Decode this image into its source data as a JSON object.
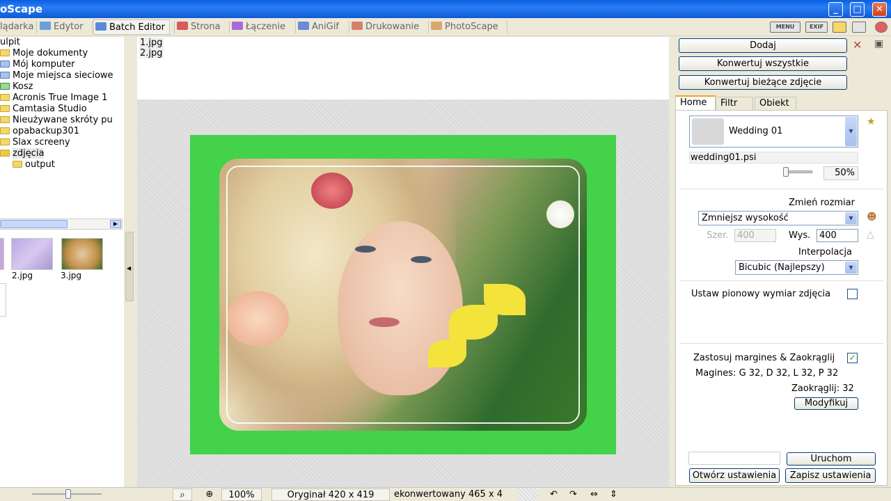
{
  "window": {
    "title": "oScape",
    "controls": [
      "_",
      "□",
      "✕"
    ]
  },
  "tabs": [
    {
      "label": "lądarka",
      "color": "#9bb5e8"
    },
    {
      "label": "Edytor",
      "color": "#6aa0d8"
    },
    {
      "label": "Batch Editor",
      "color": "#5a8ad8",
      "active": true
    },
    {
      "label": "Strona",
      "color": "#d85a5a"
    },
    {
      "label": "Łączenie",
      "color": "#a86ad8"
    },
    {
      "label": "AniGif",
      "color": "#6a8ad8"
    },
    {
      "label": "Drukowanie",
      "color": "#d8806a"
    },
    {
      "label": "PhotoScape",
      "color": "#d8a86a"
    }
  ],
  "toolbar_icons": {
    "menu": "MENU",
    "exif": "EXIF"
  },
  "tree": [
    {
      "label": "ulpit",
      "level": 0,
      "icon": "desktop-icon"
    },
    {
      "label": "Moje dokumenty",
      "level": 1,
      "icon": "folder-icon"
    },
    {
      "label": "Mój komputer",
      "level": 1,
      "icon": "computer-icon"
    },
    {
      "label": "Moje miejsca sieciowe",
      "level": 1,
      "icon": "network-icon"
    },
    {
      "label": "Kosz",
      "level": 1,
      "icon": "recycle-bin-icon"
    },
    {
      "label": "Acronis True Image 1",
      "level": 1,
      "icon": "folder-icon"
    },
    {
      "label": "Camtasia Studio",
      "level": 1,
      "icon": "folder-icon"
    },
    {
      "label": "Nieużywane skróty pu",
      "level": 1,
      "icon": "folder-icon"
    },
    {
      "label": "opabackup301",
      "level": 1,
      "icon": "folder-icon"
    },
    {
      "label": "Slax screeny",
      "level": 1,
      "icon": "folder-icon"
    },
    {
      "label": "zdjęcia",
      "level": 1,
      "icon": "folder-icon",
      "selected": true
    },
    {
      "label": "output",
      "level": 2,
      "icon": "folder-icon"
    }
  ],
  "thumbnails": [
    {
      "label": "2.jpg"
    },
    {
      "label": "3.jpg"
    }
  ],
  "files": [
    "1.jpg",
    "2.jpg"
  ],
  "status": {
    "zoom": "100%",
    "original": "Oryginał 420 x 419",
    "converted": "ekonwertowany 465 x 4"
  },
  "right": {
    "add": "Dodaj",
    "convert_all": "Konwertuj wszystkie",
    "convert_current": "Konwertuj bieżące zdjęcie",
    "tabs": [
      "Home",
      "Filtr",
      "Obiekt"
    ],
    "frame_name": "Wedding 01",
    "frame_file": "wedding01.psi",
    "frame_opacity": "50%",
    "resize_label": "Zmień rozmiar",
    "resize_mode": "Zmniejsz wysokość",
    "width_label": "Szer.",
    "width_value": "400",
    "height_label": "Wys.",
    "height_value": "400",
    "interp_label": "Interpolacja",
    "interp_value": "Bicubic (Najlepszy)",
    "portrait_label": "Ustaw pionowy wymiar zdjęcia",
    "margins_label": "Zastosuj margines & Zaokrąglij",
    "margins_value": "Magines: G 32, D 32, L 32, P 32",
    "round_value": "Zaokrąglij: 32",
    "modify": "Modyfikuj",
    "run": "Uruchom",
    "open_settings": "Otwórz ustawienia",
    "save_settings": "Zapisz ustawienia"
  },
  "colors": {
    "frame_green": "#43d24a",
    "title_blue": "#0a5fe0"
  }
}
